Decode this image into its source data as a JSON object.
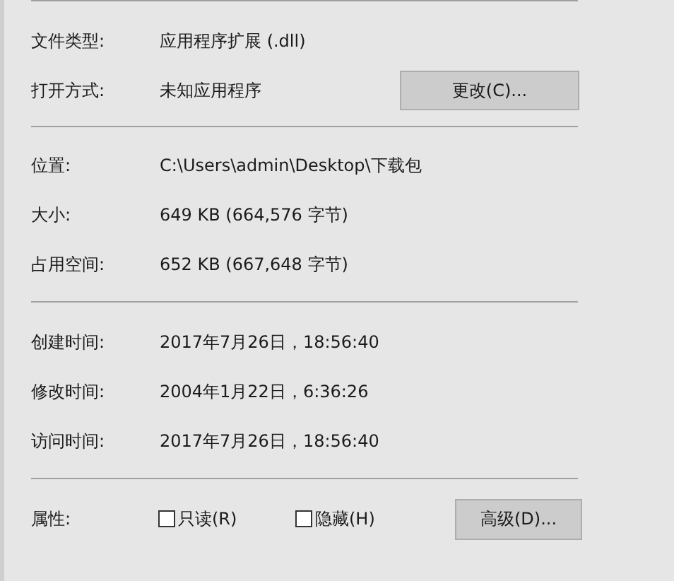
{
  "general": [
    {
      "label": "文件类型:",
      "value": "应用程序扩展 (.dll)"
    },
    {
      "label": "打开方式:",
      "value": "未知应用程序",
      "button": "更改(C)..."
    }
  ],
  "location": [
    {
      "label": "位置:",
      "value": "C:\\Users\\admin\\Desktop\\下载包"
    },
    {
      "label": "大小:",
      "value": "649 KB (664,576 字节)"
    },
    {
      "label": "占用空间:",
      "value": "652 KB (667,648 字节)"
    }
  ],
  "times": [
    {
      "label": "创建时间:",
      "value": "2017年7月26日，18:56:40"
    },
    {
      "label": "修改时间:",
      "value": "2004年1月22日，6:36:26"
    },
    {
      "label": "访问时间:",
      "value": "2017年7月26日，18:56:40"
    }
  ],
  "attributes": {
    "label": "属性:",
    "options": [
      {
        "label": "只读(R)",
        "checked": false
      },
      {
        "label": "隐藏(H)",
        "checked": false
      }
    ],
    "button": "高级(D)..."
  }
}
